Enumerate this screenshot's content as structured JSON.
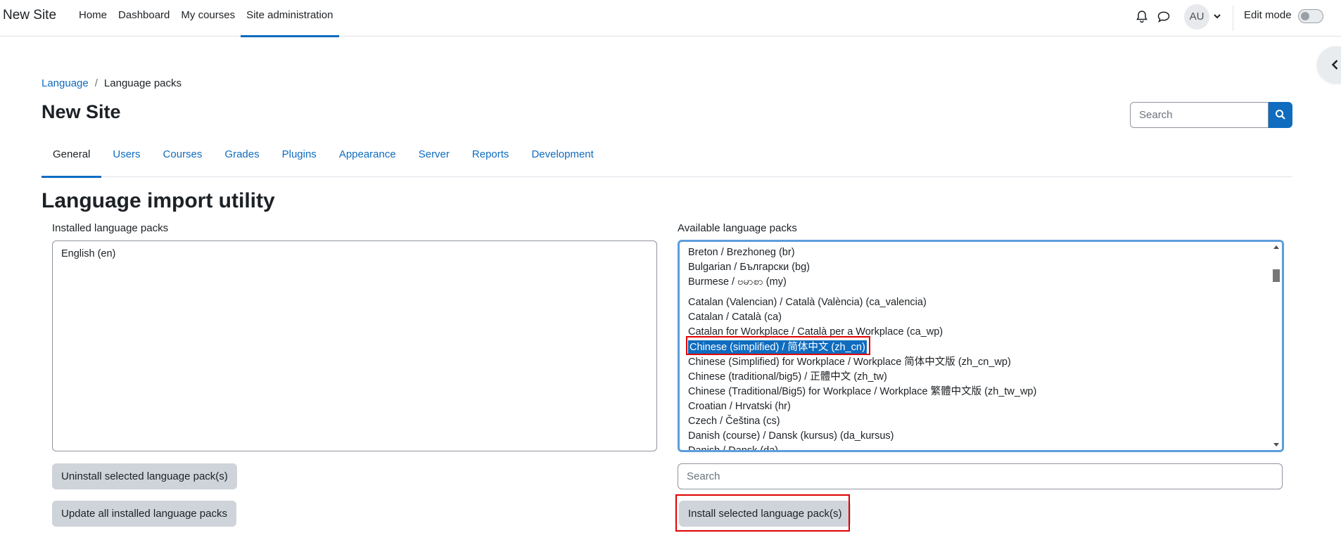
{
  "navbar": {
    "brand": "New Site",
    "links": [
      "Home",
      "Dashboard",
      "My courses",
      "Site administration"
    ],
    "active_link": "Site administration",
    "avatar_initials": "AU",
    "edit_mode_label": "Edit mode",
    "icons": [
      "bell-icon",
      "chat-bubble-icon",
      "chevron-down-icon"
    ]
  },
  "breadcrumb": [
    "Language",
    "Language packs"
  ],
  "page_title": "New Site",
  "header_search": {
    "placeholder": "Search"
  },
  "tabs": [
    "General",
    "Users",
    "Courses",
    "Grades",
    "Plugins",
    "Appearance",
    "Server",
    "Reports",
    "Development"
  ],
  "active_tab": "General",
  "main": {
    "heading": "Language import utility",
    "installed": {
      "label": "Installed language packs",
      "items": [
        "English (en)"
      ],
      "uninstall_label": "Uninstall selected language pack(s)",
      "update_label": "Update all installed language packs"
    },
    "available": {
      "label": "Available language packs",
      "items": [
        "Breton / Brezhoneg (br)",
        "Bulgarian / Български (bg)",
        "Burmese / ဗမာစာ (my)",
        "Catalan (Valencian) / Català (València) (ca_valencia)",
        "Catalan / Català (ca)",
        "Catalan for Workplace / Català per a Workplace (ca_wp)",
        "Chinese (simplified) / 简体中文 (zh_cn)",
        "Chinese (Simplified) for Workplace / Workplace 简体中文版 (zh_cn_wp)",
        "Chinese (traditional/big5) / 正體中文 (zh_tw)",
        "Chinese (Traditional/Big5) for Workplace / Workplace 繁體中文版 (zh_tw_wp)",
        "Croatian / Hrvatski (hr)",
        "Czech / Čeština (cs)",
        "Danish (course) / Dansk (kursus) (da_kursus)",
        "Danish / Dansk (da)"
      ],
      "selected": "Chinese (simplified) / 简体中文 (zh_cn)",
      "search_placeholder": "Search",
      "install_label": "Install selected language pack(s)"
    }
  },
  "colors": {
    "primary": "#0f6cbf",
    "button_gray": "#ced4da",
    "highlight": "#e00000",
    "focus": "#5d9ddb"
  }
}
